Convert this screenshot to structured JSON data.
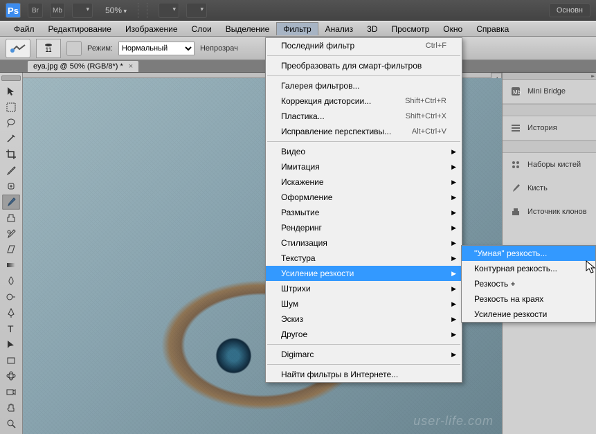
{
  "titlebar": {
    "logo": "Ps",
    "br": "Br",
    "mb": "Mb",
    "zoom": "50%",
    "main_button": "Основн"
  },
  "menubar": {
    "items": [
      "Файл",
      "Редактирование",
      "Изображение",
      "Слои",
      "Выделение",
      "Фильтр",
      "Анализ",
      "3D",
      "Просмотр",
      "Окно",
      "Справка"
    ],
    "active_index": 5
  },
  "options": {
    "brush_size": "11",
    "mode_label": "Режим:",
    "mode_value": "Нормальный",
    "opacity_label": "Непрозрач"
  },
  "document": {
    "tab_title": "eya.jpg @ 50% (RGB/8*) *"
  },
  "filter_menu": {
    "sections": [
      [
        {
          "label": "Последний фильтр",
          "shortcut": "Ctrl+F"
        }
      ],
      [
        {
          "label": "Преобразовать для смарт-фильтров"
        }
      ],
      [
        {
          "label": "Галерея фильтров..."
        },
        {
          "label": "Коррекция дисторсии...",
          "shortcut": "Shift+Ctrl+R"
        },
        {
          "label": "Пластика...",
          "shortcut": "Shift+Ctrl+X"
        },
        {
          "label": "Исправление перспективы...",
          "shortcut": "Alt+Ctrl+V"
        }
      ],
      [
        {
          "label": "Видео",
          "submenu": true
        },
        {
          "label": "Имитация",
          "submenu": true
        },
        {
          "label": "Искажение",
          "submenu": true
        },
        {
          "label": "Оформление",
          "submenu": true
        },
        {
          "label": "Размытие",
          "submenu": true
        },
        {
          "label": "Рендеринг",
          "submenu": true
        },
        {
          "label": "Стилизация",
          "submenu": true
        },
        {
          "label": "Текстура",
          "submenu": true
        },
        {
          "label": "Усиление резкости",
          "submenu": true,
          "highlighted": true
        },
        {
          "label": "Штрихи",
          "submenu": true
        },
        {
          "label": "Шум",
          "submenu": true
        },
        {
          "label": "Эскиз",
          "submenu": true
        },
        {
          "label": "Другое",
          "submenu": true
        }
      ],
      [
        {
          "label": "Digimarc",
          "submenu": true
        }
      ],
      [
        {
          "label": "Найти фильтры в Интернете..."
        }
      ]
    ]
  },
  "sharpen_submenu": {
    "items": [
      {
        "label": "\"Умная\" резкость...",
        "highlighted": true
      },
      {
        "label": "Контурная резкость..."
      },
      {
        "label": "Резкость +"
      },
      {
        "label": "Резкость на краях"
      },
      {
        "label": "Усиление резкости"
      }
    ]
  },
  "right_panel": {
    "items": [
      {
        "label": "Mini Bridge",
        "icon": "mb"
      },
      {
        "label": "История",
        "icon": "history"
      },
      {
        "label": "Наборы кистей",
        "icon": "brush-presets"
      },
      {
        "label": "Кисть",
        "icon": "brush"
      },
      {
        "label": "Источник клонов",
        "icon": "clone-source"
      }
    ]
  },
  "watermark": "user-life.com"
}
